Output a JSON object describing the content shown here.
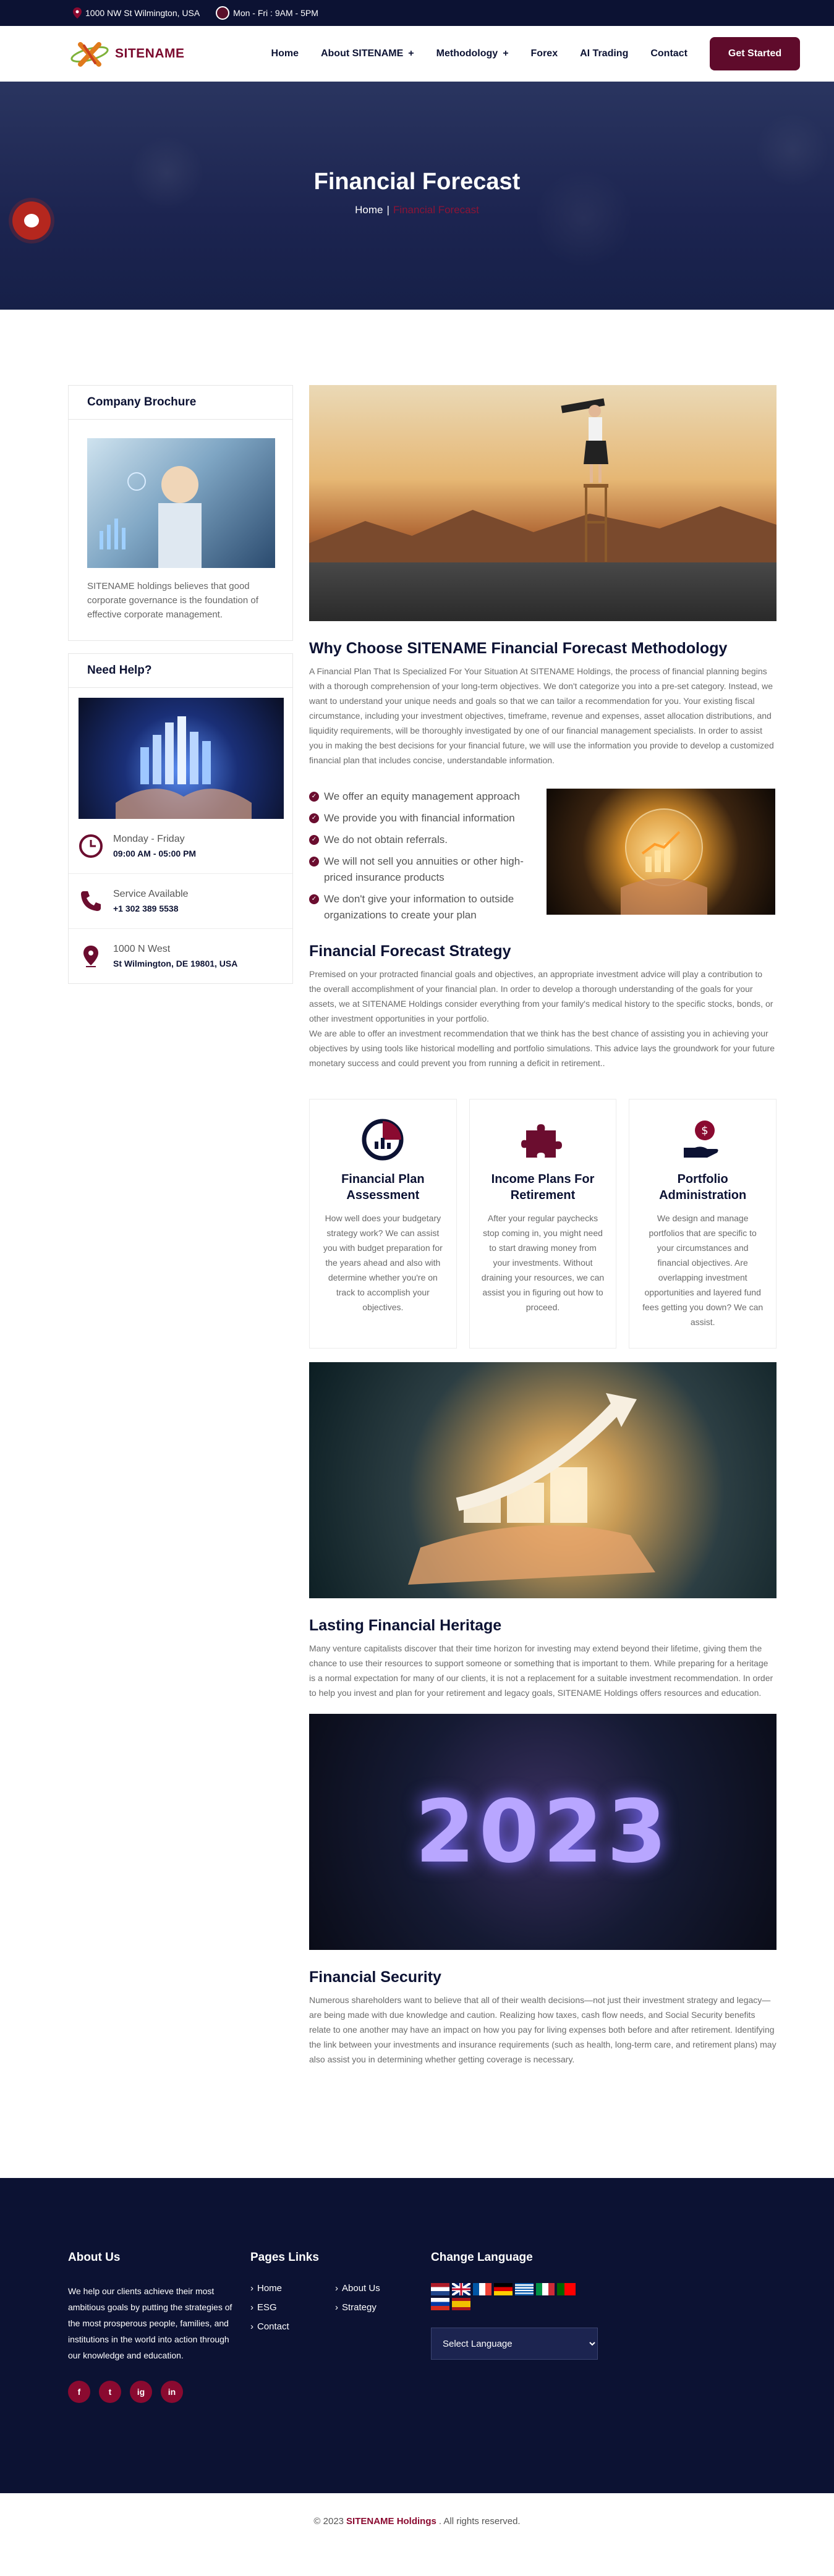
{
  "topbar": {
    "address": "1000 NW St Wilmington, USA",
    "hours": "Mon - Fri : 9AM - 5PM"
  },
  "nav": {
    "logo_text": "SITENAME",
    "items": [
      {
        "label": "Home",
        "plus": ""
      },
      {
        "label": "About SITENAME",
        "plus": "+"
      },
      {
        "label": "Methodology",
        "plus": "+"
      },
      {
        "label": "Forex",
        "plus": ""
      },
      {
        "label": "AI Trading",
        "plus": ""
      },
      {
        "label": "Contact",
        "plus": ""
      }
    ],
    "cta": "Get Started"
  },
  "hero": {
    "title": "Financial Forecast",
    "crumb_home": "Home",
    "crumb_sep": "|",
    "crumb_current": "Financial Forecast"
  },
  "sidebar": {
    "brochure_title": "Company Brochure",
    "brochure_text": "SITENAME holdings believes that good corporate governance is the foundation of effective corporate management.",
    "help_title": "Need Help?",
    "help": [
      {
        "l1": "Monday - Friday",
        "l2": "09:00 AM - 05:00 PM",
        "icon": "clock-icon"
      },
      {
        "l1": "Service Available",
        "l2": "+1 302 389 5538",
        "icon": "phone-icon"
      },
      {
        "l1": "1000 N West",
        "l2": "St Wilmington, DE 19801, USA",
        "icon": "location-icon"
      }
    ]
  },
  "content": {
    "why_title": "Why Choose SITENAME Financial Forecast Methodology",
    "why_text": "A Financial Plan That Is Specialized For Your Situation At SITENAME Holdings, the process of financial planning begins with a thorough comprehension of your long-term objectives. We don't categorize you into a pre-set category. Instead, we want to understand your unique needs and goals so that we can tailor a recommendation for you. Your existing fiscal circumstance, including your investment objectives, timeframe, revenue and expenses, asset allocation distributions, and liquidity requirements, will be thoroughly investigated by one of our financial management specialists. In order to assist you in making the best decisions for your financial future, we will use the information you provide to develop a customized financial plan that includes concise, understandable information.",
    "checks": [
      "We offer an equity management approach",
      "We provide you with financial information",
      "We do not obtain referrals.",
      "We will not sell you annuities or other high-priced insurance products",
      "We don't give your information to outside organizations to create your plan"
    ],
    "strategy_title": "Financial Forecast Strategy",
    "strategy_text1": "Premised on your protracted financial goals and objectives, an appropriate investment advice will play a contribution to the overall accomplishment of your financial plan. In order to develop a thorough understanding of the goals for your assets, we at SITENAME Holdings consider everything from your family's medical history to the specific stocks, bonds, or other investment opportunities in your portfolio.",
    "strategy_text2": "We are able to offer an investment recommendation that we think has the best chance of assisting you in achieving your objectives by using tools like historical modelling and portfolio simulations. This advice lays the groundwork for your future monetary success and could prevent you from running a deficit in retirement..",
    "services": [
      {
        "title": "Financial Plan Assessment",
        "text": "How well does your budgetary strategy work? We can assist you with budget preparation for the years ahead and also with determine whether you're on track to accomplish your objectives.",
        "icon": "pie-chart-icon"
      },
      {
        "title": "Income Plans For Retirement",
        "text": "After your regular paychecks stop coming in, you might need to start drawing money from your investments. Without draining your resources, we can assist you in figuring out how to proceed.",
        "icon": "puzzle-icon"
      },
      {
        "title": "Portfolio Administration",
        "text": "We design and manage portfolios that are specific to your circumstances and financial objectives. Are overlapping investment opportunities and layered fund fees getting you down? We can assist.",
        "icon": "money-hand-icon"
      }
    ],
    "heritage_title": "Lasting Financial Heritage",
    "heritage_text": "Many venture capitalists discover that their time horizon for investing may extend beyond their lifetime, giving them the chance to use their resources to support someone or something that is important to them. While preparing for a heritage is a normal expectation for many of our clients, it is not a replacement for a suitable investment recommendation. In order to help you invest and plan for your retirement and legacy goals, SITENAME Holdings offers resources and education.",
    "year_text": "2023",
    "security_title": "Financial Security",
    "security_text": "Numerous shareholders want to believe that all of their wealth decisions—not just their investment strategy and legacy—are being made with due knowledge and caution. Realizing how taxes, cash flow needs, and Social Security benefits relate to one another may have an impact on how you pay for living expenses both before and after retirement. Identifying the link between your investments and insurance requirements (such as health, long-term care, and retirement plans) may also assist you in determining whether getting coverage is necessary."
  },
  "footer": {
    "about_title": "About Us",
    "about_text": "We help our clients achieve their most ambitious goals by putting the strategies of the most prosperous people, families, and institutions in the world into action through our knowledge and education.",
    "pages_title": "Pages Links",
    "links": [
      "Home",
      "About Us",
      "ESG",
      "Strategy",
      "Contact"
    ],
    "lang_title": "Change Language",
    "select_label": "Select Language",
    "social": [
      "f",
      "t",
      "ig",
      "in"
    ],
    "copy_pre": "© 2023",
    "copy_brand": "SITENAME Holdings",
    "copy_post": ". All rights reserved."
  },
  "colors": {
    "navy": "#0c1233",
    "brand": "#5f0b2b",
    "accent": "#8a0a30"
  }
}
